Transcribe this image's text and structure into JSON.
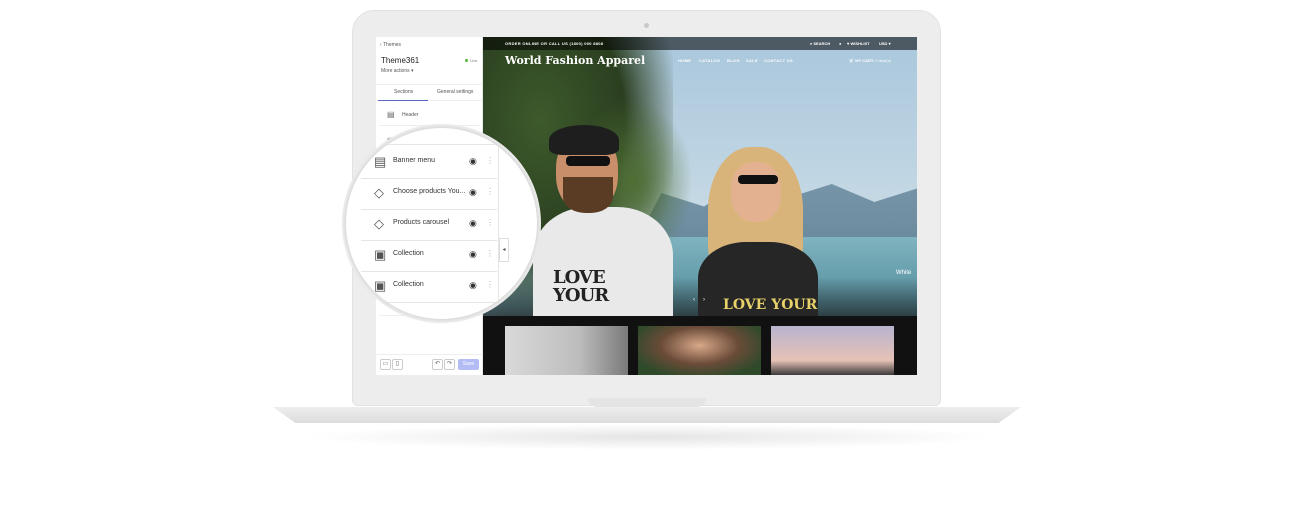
{
  "sidebar": {
    "back_label": "Themes",
    "theme_name": "Theme361",
    "live_label": "Live",
    "more_actions": "More actions",
    "tabs": [
      {
        "label": "Sections"
      },
      {
        "label": "General settings"
      }
    ],
    "rows": [
      {
        "label": "Header",
        "icon": "layout-header-icon"
      },
      {
        "label": "",
        "icon": "layout-banner-icon"
      }
    ],
    "save_label": "Save"
  },
  "magnifier": {
    "rows": [
      {
        "label": "Banner menu",
        "icon": "layout-banner-icon"
      },
      {
        "label": "Choose products You...",
        "icon": "tag-icon"
      },
      {
        "label": "Products carousel",
        "icon": "tag-icon"
      },
      {
        "label": "Collection",
        "icon": "collection-icon"
      },
      {
        "label": "Collection",
        "icon": "collection-icon"
      }
    ]
  },
  "site": {
    "topbar_text": "ORDER ONLINE OR CALL US (1800) 000 8808",
    "search_label": "SEARCH",
    "wishlist_label": "WISHLIST",
    "currency_label": "USD",
    "title": "World Fashion Apparel",
    "nav": [
      "HOME",
      "CATALOG",
      "BLOG",
      "SALE",
      "CONTACT US"
    ],
    "cart_label": "MY CART:",
    "cart_count": "0 item(s)",
    "slide_caption": "White",
    "man_shirt_text": "LOVE YOUR",
    "woman_shirt_text": "LOVE YOUR"
  }
}
